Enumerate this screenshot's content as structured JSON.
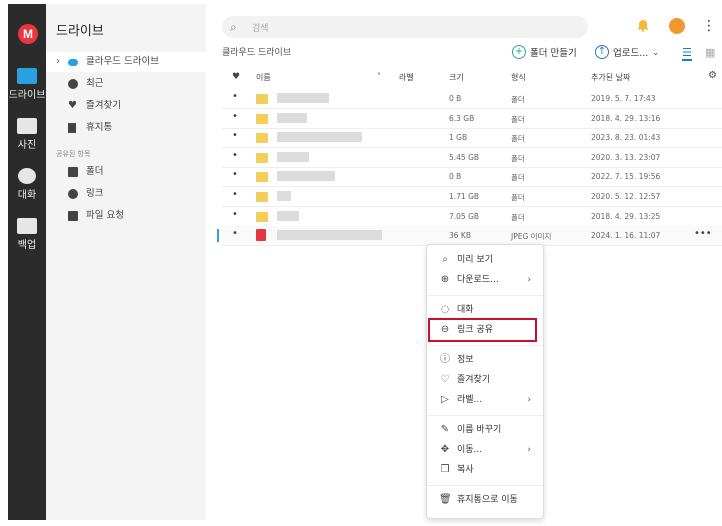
{
  "rail": [
    {
      "label": "드라이브",
      "icon": "folder-icon"
    },
    {
      "label": "사진",
      "icon": "photo-icon"
    },
    {
      "label": "대화",
      "icon": "chat-icon"
    },
    {
      "label": "백업",
      "icon": "backup-icon"
    }
  ],
  "logo_letter": "M",
  "sidebar": {
    "title": "드라이브",
    "items": [
      {
        "label": "클라우드 드라이브",
        "icon": "cloud-icon"
      },
      {
        "label": "최근",
        "icon": "clock-icon"
      },
      {
        "label": "즐겨찾기",
        "icon": "heart-icon"
      },
      {
        "label": "휴지통",
        "icon": "trash-icon"
      }
    ],
    "section_label": "공유된 항목",
    "shared_items": [
      {
        "label": "폴더",
        "icon": "shared-folder-icon"
      },
      {
        "label": "링크",
        "icon": "link-icon"
      },
      {
        "label": "파일 요청",
        "icon": "file-request-icon"
      }
    ]
  },
  "search": {
    "placeholder": "검색"
  },
  "breadcrumb": "클라우드 드라이브",
  "toolbar": {
    "new_folder": "폴더 만들기",
    "upload": "업로드..."
  },
  "table": {
    "headers": {
      "name": "이름",
      "label": "라벨",
      "size": "크기",
      "type": "형식",
      "added": "추가된 날짜"
    },
    "rows": [
      {
        "size": "0 B",
        "type": "폴더",
        "date": "2019. 5. 7. 17:43"
      },
      {
        "size": "6.3 GB",
        "type": "폴더",
        "date": "2018. 4. 29. 13:16"
      },
      {
        "size": "1 GB",
        "type": "폴더",
        "date": "2023. 8. 23. 01:43"
      },
      {
        "size": "5.45 GB",
        "type": "폴더",
        "date": "2020. 3. 13. 23:07"
      },
      {
        "size": "0 B",
        "type": "폴더",
        "date": "2022. 7. 15. 19:56"
      },
      {
        "size": "1.71 GB",
        "type": "폴더",
        "date": "2020. 5. 12. 12:57"
      },
      {
        "size": "7.05 GB",
        "type": "폴더",
        "date": "2018. 4. 29. 13:25"
      },
      {
        "size": "36 KB",
        "type": "JPEG 이미지",
        "date": "2024. 1. 16. 11:07"
      }
    ]
  },
  "context_menu": [
    {
      "label": "미리 보기",
      "icon": "search-icon"
    },
    {
      "label": "다운로드...",
      "icon": "download-icon",
      "submenu": true
    },
    {
      "label": "대화",
      "icon": "chat-icon"
    },
    {
      "label": "링크 공유",
      "icon": "link-icon"
    },
    {
      "label": "정보",
      "icon": "info-icon"
    },
    {
      "label": "즐겨찾기",
      "icon": "heart-icon"
    },
    {
      "label": "라벨...",
      "icon": "label-icon",
      "submenu": true
    },
    {
      "label": "이름 바꾸기",
      "icon": "pencil-icon"
    },
    {
      "label": "이동...",
      "icon": "move-icon",
      "submenu": true
    },
    {
      "label": "복사",
      "icon": "copy-icon"
    },
    {
      "label": "휴지통으로 이동",
      "icon": "trash-icon"
    }
  ],
  "colors": {
    "accent": "#2aa0e0",
    "logo": "#e8373e",
    "highlight": "#c8102e",
    "folder": "#f3ce5b"
  }
}
